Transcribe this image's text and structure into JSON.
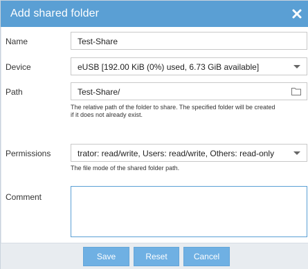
{
  "dialog": {
    "title": "Add shared folder",
    "accent_color": "#5a9fd4",
    "close_icon": "close-icon"
  },
  "form": {
    "name": {
      "label": "Name",
      "value": "Test-Share"
    },
    "device": {
      "label": "Device",
      "value": "eUSB [192.00 KiB (0%) used, 6.73 GiB available]"
    },
    "path": {
      "label": "Path",
      "value": "Test-Share/",
      "hint_line1": "The relative path of the folder to share. The specified folder will be created",
      "hint_line2": "if it does not already exist.",
      "icon": "folder-icon"
    },
    "permissions": {
      "label": "Permissions",
      "value": "trator: read/write, Users: read/write, Others: read-only",
      "hint": "The file mode of the shared folder path."
    },
    "comment": {
      "label": "Comment",
      "value": ""
    }
  },
  "buttons": {
    "save": "Save",
    "reset": "Reset",
    "cancel": "Cancel"
  }
}
